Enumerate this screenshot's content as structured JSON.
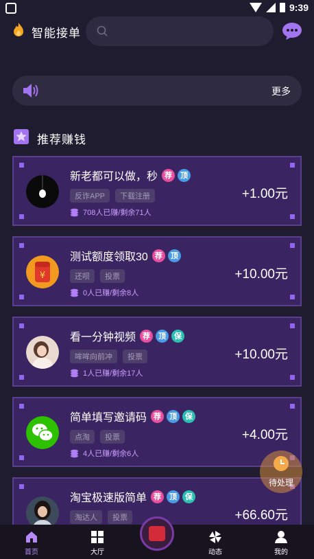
{
  "status_bar": {
    "time": "9:39"
  },
  "header": {
    "brand": "智能接单",
    "search_placeholder": ""
  },
  "notice": {
    "more_label": "更多"
  },
  "section": {
    "title": "推荐赚钱"
  },
  "tasks": [
    {
      "title": "新老都可以做，秒",
      "badges": [
        "荐",
        "顶"
      ],
      "tags": [
        "反诈APP",
        "下载注册"
      ],
      "progress": "708人已赚/剩余71人",
      "reward": "+1.00元",
      "avatar": "bulb-avatar"
    },
    {
      "title": "测试额度领取30",
      "badges": [
        "荐",
        "顶"
      ],
      "tags": [
        "还呗",
        "投票"
      ],
      "progress": "0人已赚/剩余8人",
      "reward": "+10.00元",
      "avatar": "redpacket-avatar"
    },
    {
      "title": "看一分钟视频",
      "badges": [
        "荐",
        "顶",
        "保"
      ],
      "tags": [
        "哞哞向前冲",
        "投票"
      ],
      "progress": "1人已赚/剩余17人",
      "reward": "+10.00元",
      "avatar": "girl-avatar"
    },
    {
      "title": "简单填写邀请码",
      "badges": [
        "荐",
        "顶",
        "保"
      ],
      "tags": [
        "点淘",
        "投票"
      ],
      "progress": "4人已赚/剩余6人",
      "reward": "+4.00元",
      "avatar": "wechat-avatar"
    },
    {
      "title": "淘宝极速版简单",
      "badges": [
        "荐",
        "顶",
        "保"
      ],
      "tags": [
        "淘达人",
        "投票"
      ],
      "progress": "",
      "reward": "+66.60元",
      "avatar": "woman-avatar"
    }
  ],
  "pending": {
    "label": "待处理"
  },
  "nav": {
    "home": "首页",
    "hall": "大厅",
    "moments": "动态",
    "mine": "我的"
  },
  "colors": {
    "background": "#201c30",
    "card": "#3a2562",
    "accent": "#9266f0",
    "active_nav": "#b58af8"
  }
}
